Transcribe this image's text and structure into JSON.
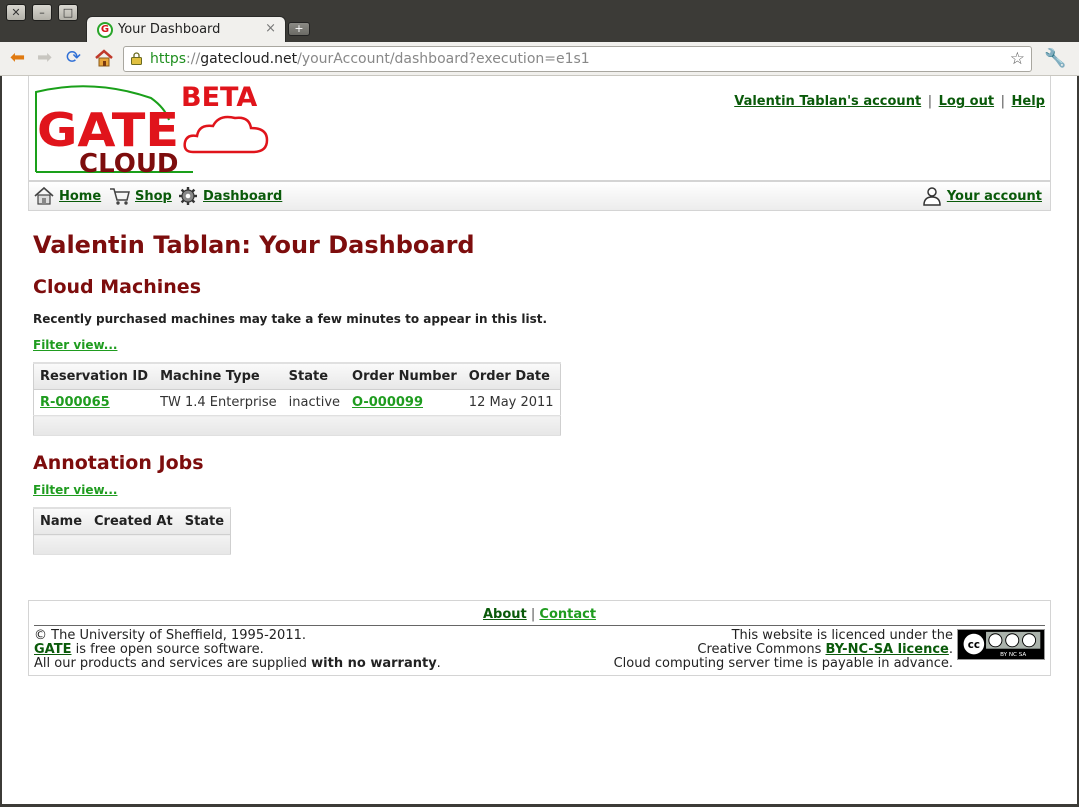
{
  "browser": {
    "tab_title": "Your Dashboard",
    "tab_close": "×",
    "new_tab": "+",
    "url_scheme": "https",
    "url_sep": "://",
    "url_host": "gatecloud.net",
    "url_path": "/yourAccount/dashboard?execution=e1s1",
    "window_close": "✕",
    "window_minimize": "–",
    "window_maximize": "□"
  },
  "header": {
    "logo_beta": "BETA",
    "logo_gate": "GATE",
    "logo_cloud": "CLOUD",
    "account_link": "Valentin Tablan's account",
    "logout_link": "Log out",
    "help_link": "Help",
    "sep": "|"
  },
  "nav": {
    "home": "Home",
    "shop": "Shop",
    "dashboard": "Dashboard",
    "your_account": "Your account"
  },
  "main": {
    "title": "Valentin Tablan: Your Dashboard",
    "cloud_machines": {
      "heading": "Cloud Machines",
      "note": "Recently purchased machines may take a few minutes to appear in this list.",
      "filter": "Filter view...",
      "columns": [
        "Reservation ID",
        "Machine Type",
        "State",
        "Order Number",
        "Order Date"
      ],
      "rows": [
        {
          "reservation_id": "R-000065",
          "machine_type": "TW 1.4 Enterprise",
          "state": "inactive",
          "order_number": "O-000099",
          "order_date": "12 May 2011"
        }
      ]
    },
    "annotation_jobs": {
      "heading": "Annotation Jobs",
      "filter": "Filter view...",
      "columns": [
        "Name",
        "Created At",
        "State"
      ]
    }
  },
  "footer": {
    "about": "About",
    "contact": "Contact",
    "sep": "|",
    "copyright": "© The University of Sheffield, 1995-2011.",
    "gate": "GATE",
    "gate_rest": " is free open source software.",
    "warranty_pre": "All our products and services are supplied ",
    "warranty_bold": "with no warranty",
    "warranty_post": ".",
    "licence_line1": "This website is licenced under the",
    "licence_line2_pre": "Creative Commons ",
    "licence_link": "BY-NC-SA licence",
    "licence_line2_post": ".",
    "licence_line3": "Cloud computing server time is payable in advance.",
    "cc_badge": "BY NC SA"
  },
  "colors": {
    "heading": "#7d0d0d",
    "link": "#0a5a0a",
    "link_bright": "#1f9c1f",
    "logo_red": "#e0141b",
    "logo_green": "#1aa01a"
  }
}
